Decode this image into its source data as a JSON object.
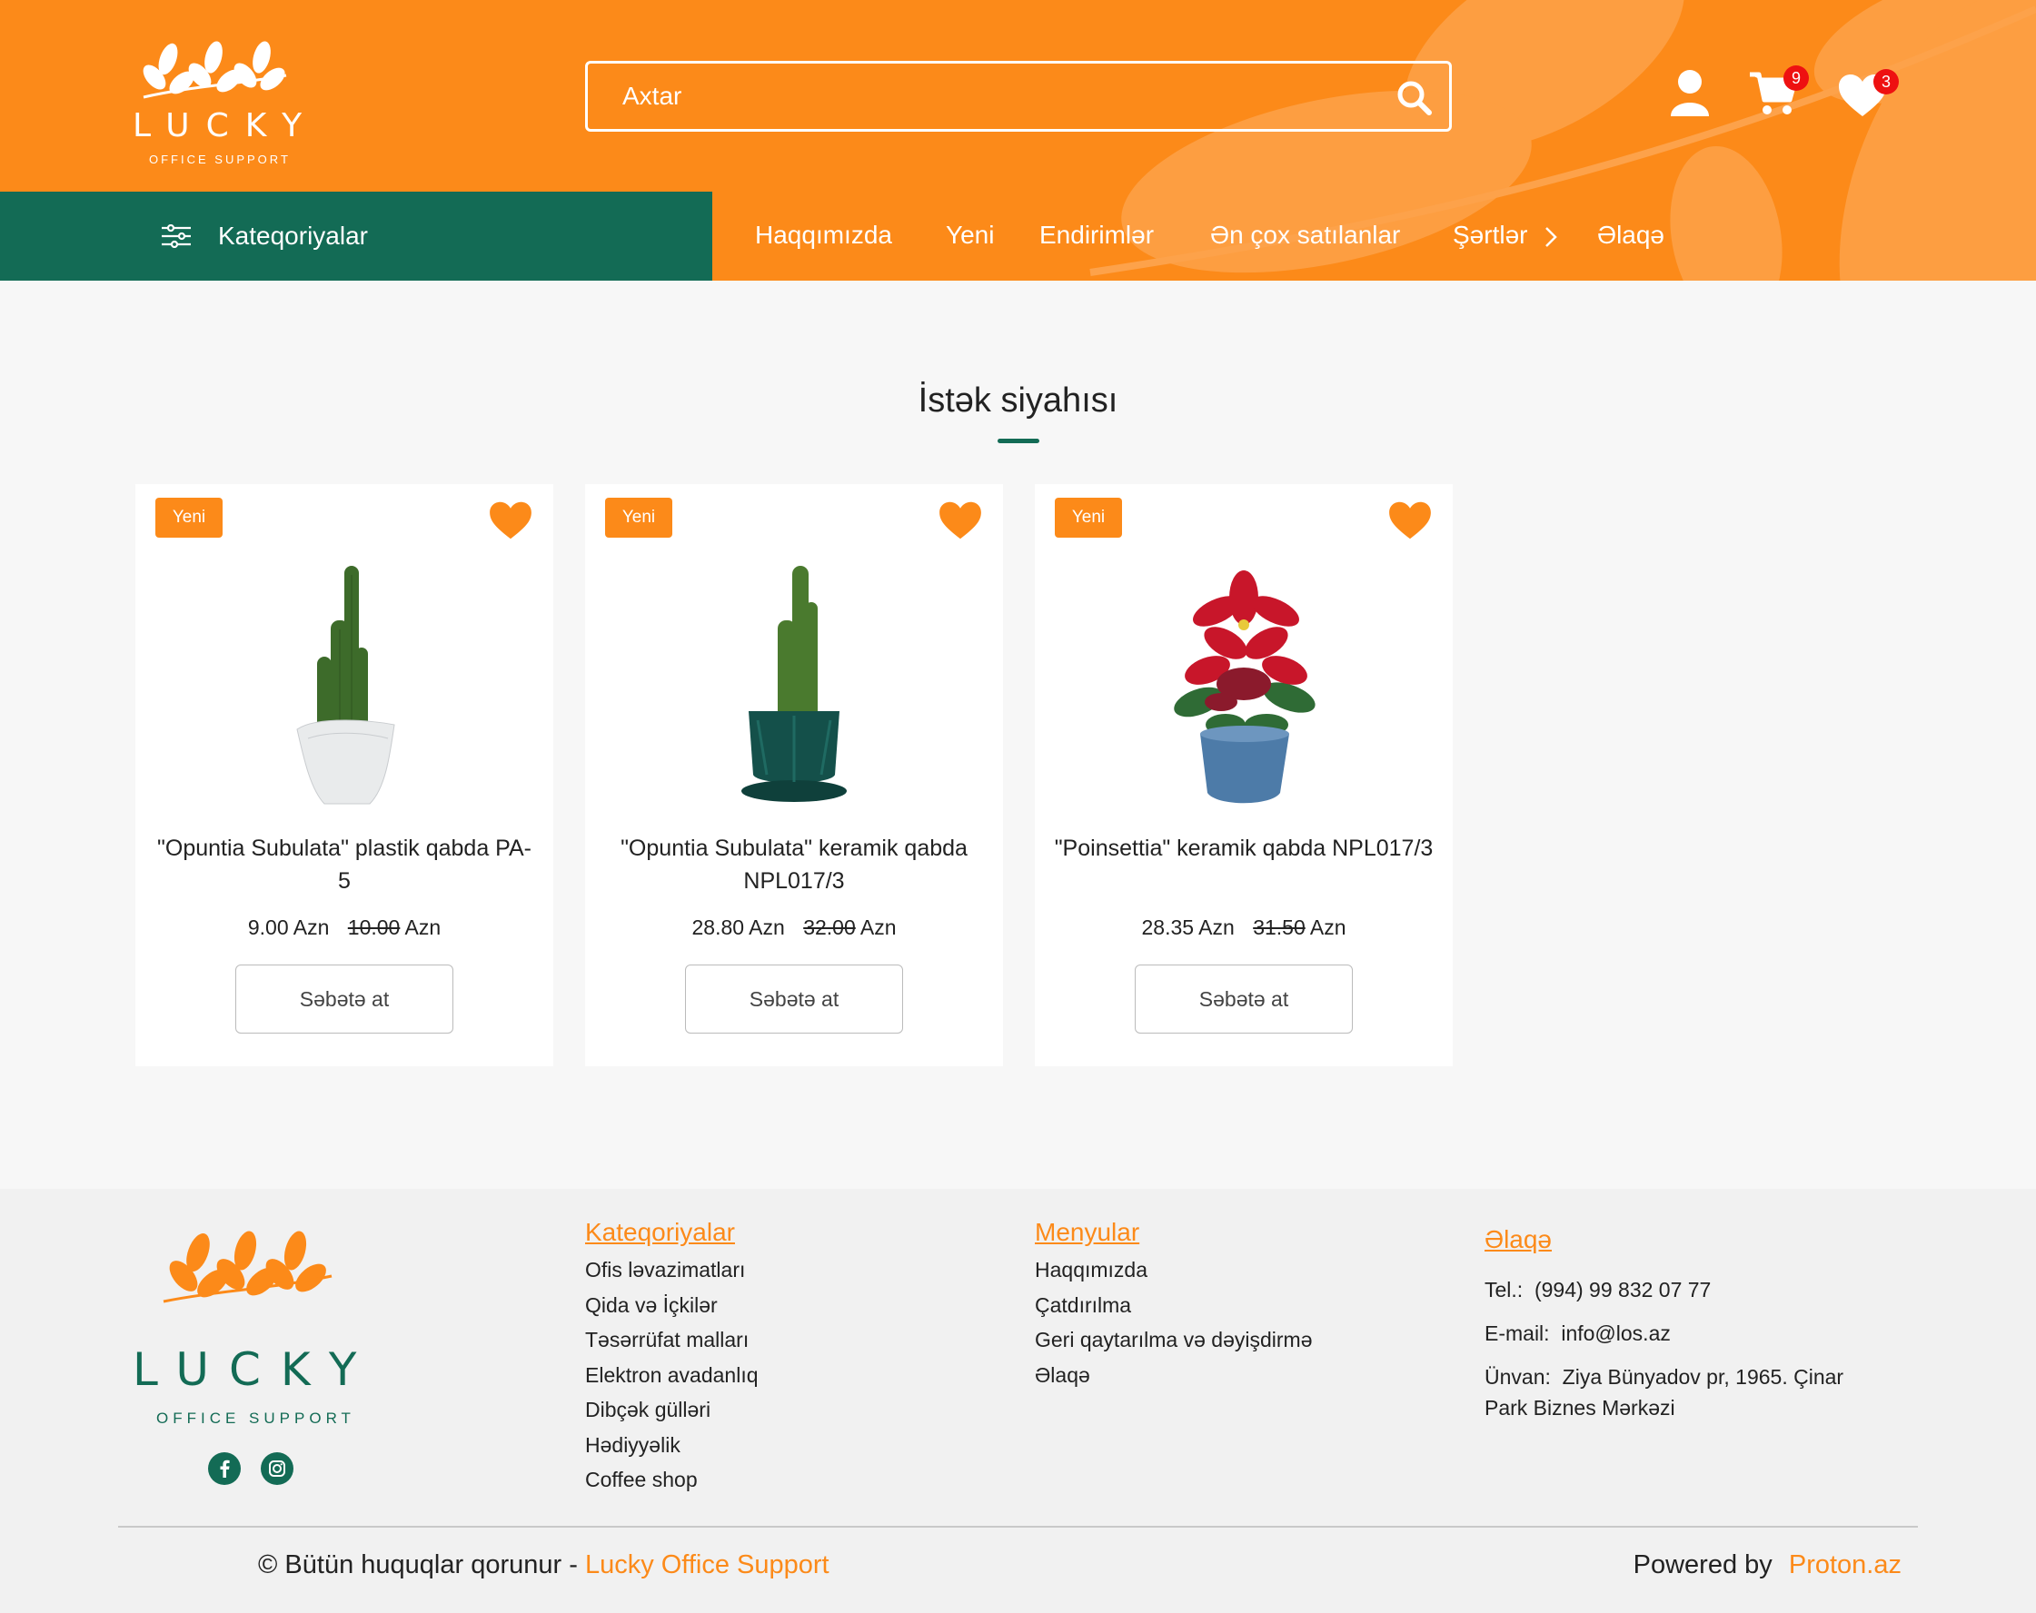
{
  "brand": {
    "name": "LUCKY",
    "tagline": "OFFICE SUPPORT"
  },
  "colors": {
    "primary_orange": "#fc8a19",
    "primary_green": "#136b55",
    "badge_red": "#ee1111"
  },
  "search": {
    "placeholder": "Axtar"
  },
  "header_icons": {
    "cart_count": "9",
    "wishlist_count": "3"
  },
  "categories_label": "Kateqoriyalar",
  "nav": [
    {
      "label": "Haqqımızda"
    },
    {
      "label": "Yeni"
    },
    {
      "label": "Endirimlər"
    },
    {
      "label": "Ən çox satılanlar"
    },
    {
      "label": "Şərtlər"
    },
    {
      "label": "Əlaqə"
    }
  ],
  "page": {
    "title": "İstək siyahısı"
  },
  "products": [
    {
      "tag": "Yeni",
      "name": "\"Opuntia Subulata\" plastik qabda PA-5",
      "price": "9.00 Azn",
      "old_price": "10.00",
      "currency": "Azn",
      "button": "Səbətə at"
    },
    {
      "tag": "Yeni",
      "name": "\"Opuntia Subulata\" keramik qabda NPL017/3",
      "price": "28.80 Azn",
      "old_price": "32.00",
      "currency": "Azn",
      "button": "Səbətə at"
    },
    {
      "tag": "Yeni",
      "name": "\"Poinsettia\" keramik qabda NPL017/3",
      "price": "28.35 Azn",
      "old_price": "31.50",
      "currency": "Azn",
      "button": "Səbətə at"
    }
  ],
  "footer": {
    "categories": {
      "heading": "Kateqoriyalar",
      "items": [
        "Ofis ləvazimatları",
        "Qida və İçkilər",
        "Təsərrüfat malları",
        "Elektron avadanlıq",
        "Dibçək gülləri",
        "Hədiyyəlik",
        "Coffee shop"
      ]
    },
    "menus": {
      "heading": "Menyular",
      "items": [
        "Haqqımızda",
        "Çatdırılma",
        "Geri qaytarılma və dəyişdirmə",
        "Əlaqə"
      ]
    },
    "contact": {
      "heading": "Əlaqə",
      "tel_label": "Tel.:",
      "tel": "(994) 99 832 07 77",
      "email_label": "E-mail:",
      "email": "info@los.az",
      "address_label": "Ünvan:",
      "address_line1": "Ziya Bünyadov pr, 1965. Çinar",
      "address_line2": "Park Biznes Mərkəzi"
    },
    "copyright_prefix": "© Bütün huquqlar qorunur -",
    "copyright_brand": "Lucky Office Support",
    "powered_prefix": "Powered by",
    "powered_brand": "Proton.az",
    "social": [
      "facebook-icon",
      "instagram-icon"
    ]
  }
}
